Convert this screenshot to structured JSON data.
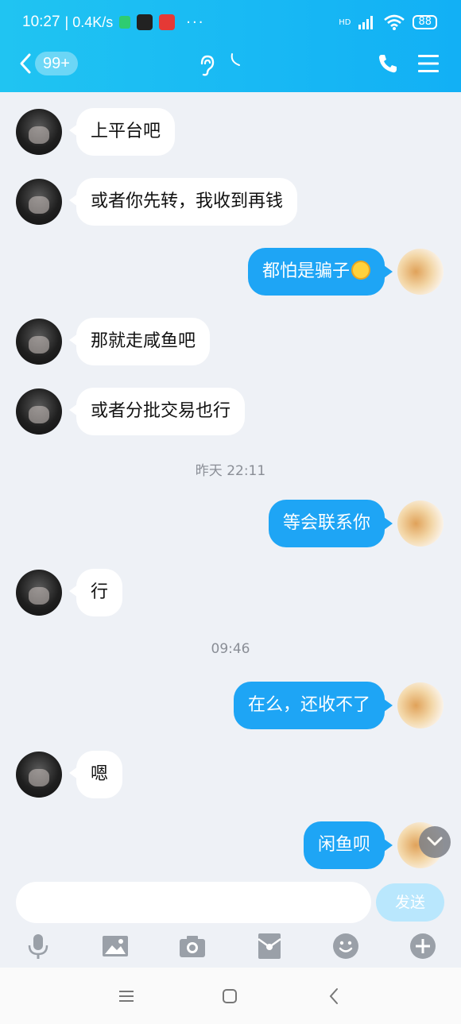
{
  "status_bar": {
    "time": "10:27",
    "speed": "| 0.4K/s",
    "network": "HD",
    "battery": "88"
  },
  "header": {
    "unread_count": "99+",
    "icons": [
      "back-chevron-icon",
      "ear-icon",
      "moon-icon",
      "phone-icon",
      "menu-icon"
    ]
  },
  "messages": [
    {
      "side": "left",
      "text": "上平台吧"
    },
    {
      "side": "left",
      "text": "或者你先转，我收到再钱"
    },
    {
      "side": "right",
      "text": "都怕是骗子"
    },
    {
      "side": "left",
      "text": "那就走咸鱼吧"
    },
    {
      "side": "left",
      "text": "或者分批交易也行"
    },
    {
      "side": "time",
      "text": "昨天 22:11"
    },
    {
      "side": "right",
      "text": "等会联系你"
    },
    {
      "side": "left",
      "text": "行"
    },
    {
      "side": "time",
      "text": "09:46"
    },
    {
      "side": "right",
      "text": "在么，还收不了"
    },
    {
      "side": "left",
      "text": "嗯"
    },
    {
      "side": "right",
      "text": "闲鱼呗"
    }
  ],
  "composer": {
    "value": "",
    "send_label": "发送"
  },
  "toolbar": {
    "items": [
      "microphone-icon",
      "image-icon",
      "camera-icon",
      "red-packet-icon",
      "emoji-icon",
      "plus-icon"
    ]
  },
  "colors": {
    "header": "#15b6f4",
    "outgoing_bubble": "#1ea5f5",
    "incoming_bubble": "#ffffff",
    "chat_bg": "#eef1f6"
  }
}
